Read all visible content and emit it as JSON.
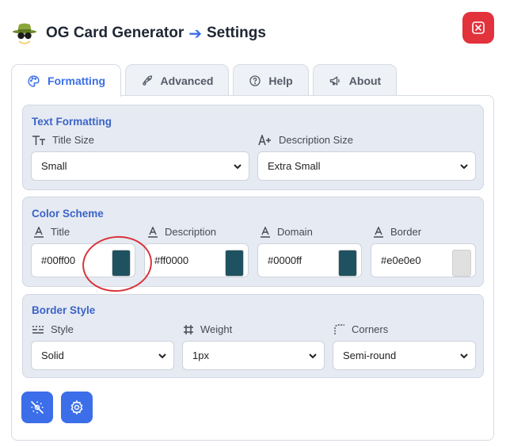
{
  "header": {
    "app_name": "OG Card Generator",
    "arrow": "➔",
    "page_name": "Settings"
  },
  "tabs": [
    {
      "label": "Formatting",
      "icon": "palette-icon",
      "active": true
    },
    {
      "label": "Advanced",
      "icon": "rocket-icon",
      "active": false
    },
    {
      "label": "Help",
      "icon": "help-circle-icon",
      "active": false
    },
    {
      "label": "About",
      "icon": "megaphone-icon",
      "active": false
    }
  ],
  "text_formatting": {
    "title": "Text Formatting",
    "title_size": {
      "label": "Title Size",
      "value": "Small"
    },
    "description_size": {
      "label": "Description Size",
      "value": "Extra Small"
    }
  },
  "color_scheme": {
    "title": "Color Scheme",
    "fields": [
      {
        "label": "Title",
        "value": "#00ff00",
        "swatch": "#1f5260"
      },
      {
        "label": "Description",
        "value": "#ff0000",
        "swatch": "#1f5260"
      },
      {
        "label": "Domain",
        "value": "#0000ff",
        "swatch": "#1f5260"
      },
      {
        "label": "Border",
        "value": "#e0e0e0",
        "swatch": "#e0e0e0"
      }
    ]
  },
  "border_style": {
    "title": "Border Style",
    "style": {
      "label": "Style",
      "value": "Solid"
    },
    "weight": {
      "label": "Weight",
      "value": "1px"
    },
    "corners": {
      "label": "Corners",
      "value": "Semi-round"
    }
  },
  "colors": {
    "accent": "#3b6ee8",
    "close": "#e2323c",
    "section_bg": "#e6eaf2",
    "section_title": "#3b64c8",
    "annotation": "#d9333a"
  },
  "actions": [
    {
      "icon": "reset-settings-icon"
    },
    {
      "icon": "settings-gear-icon"
    }
  ]
}
